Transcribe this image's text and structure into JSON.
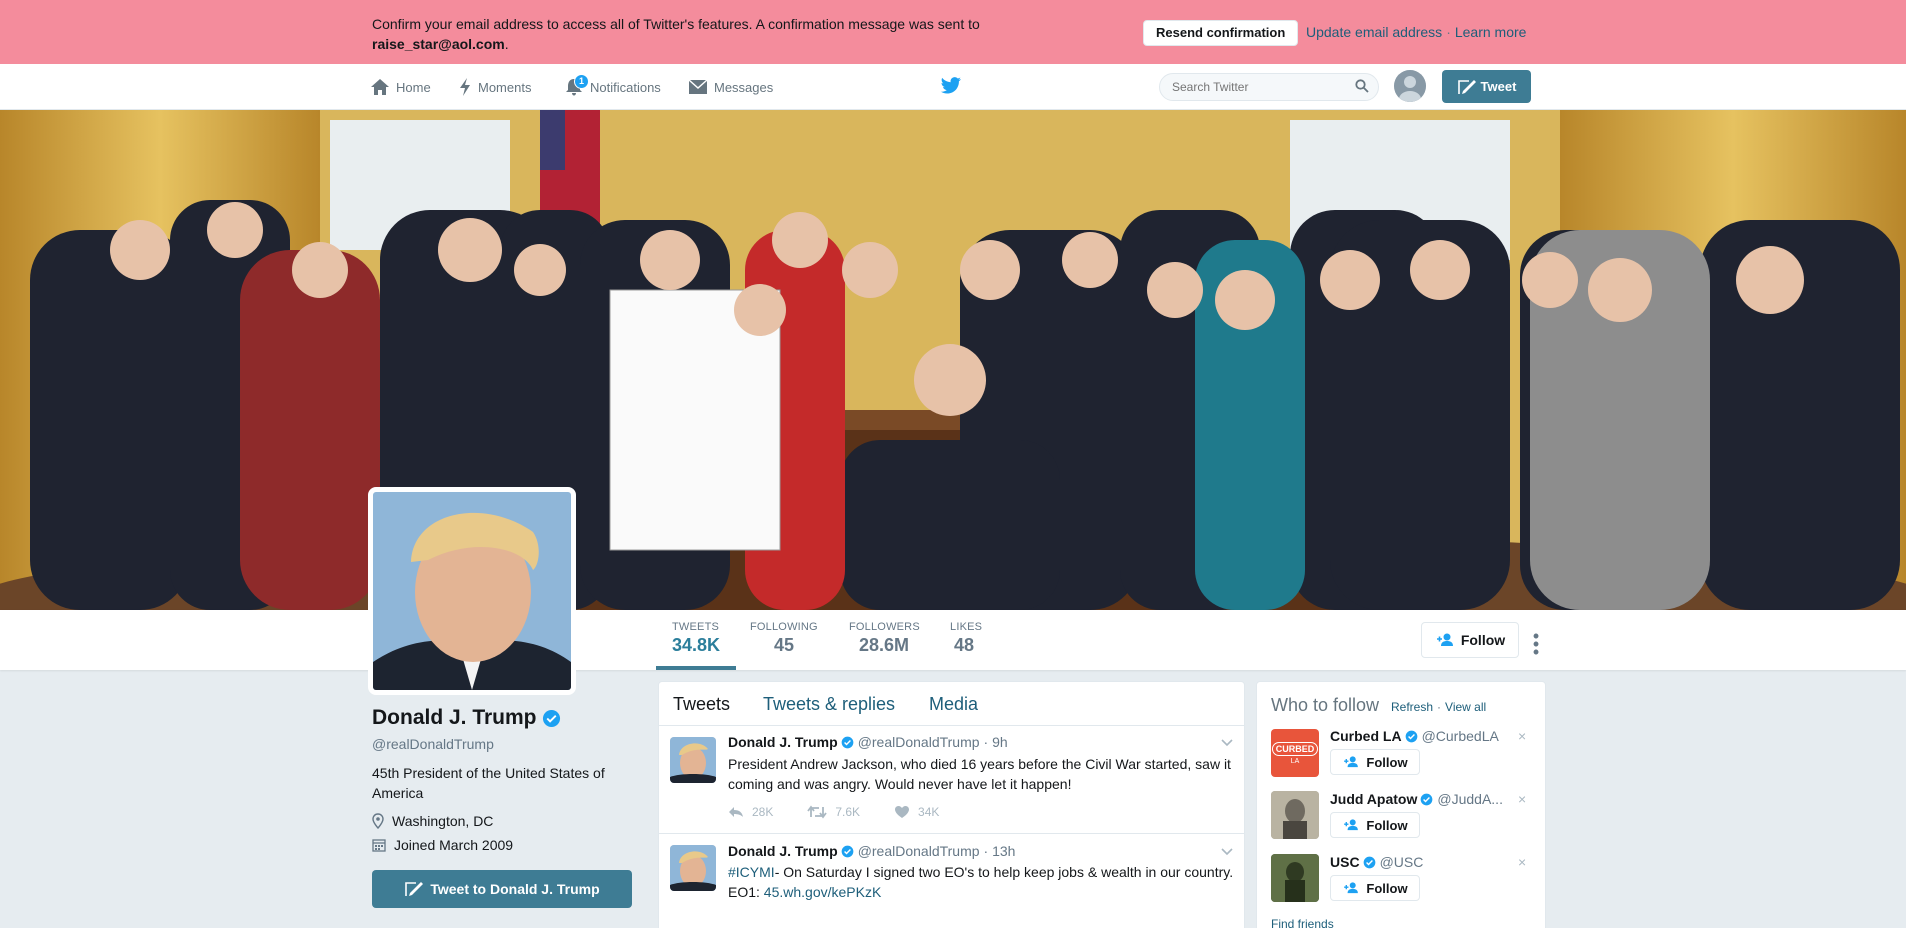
{
  "banner": {
    "message": "Confirm your email address to access all of Twitter's features. A confirmation message was sent to",
    "email": "raise_star@aol.com",
    "resend_label": "Resend confirmation",
    "update_label": "Update email address",
    "separator": "·",
    "learn_more_label": "Learn more",
    "bg_color": "#f48c9c"
  },
  "nav": {
    "items": [
      {
        "label": "Home",
        "icon": "home-icon"
      },
      {
        "label": "Moments",
        "icon": "lightning-icon"
      },
      {
        "label": "Notifications",
        "icon": "bell-icon",
        "badge": "1"
      },
      {
        "label": "Messages",
        "icon": "envelope-icon"
      }
    ],
    "search_placeholder": "Search Twitter",
    "tweet_button_label": "Tweet",
    "accent_color": "#3e7c94"
  },
  "profile": {
    "name": "Donald J. Trump",
    "handle": "@realDonaldTrump",
    "bio": "45th President of the United States of America",
    "location": "Washington, DC",
    "joined": "Joined March 2009",
    "tweet_to_label": "Tweet to Donald J. Trump",
    "verified": true
  },
  "stats": [
    {
      "label": "TWEETS",
      "value": "34.8K",
      "active": true
    },
    {
      "label": "FOLLOWING",
      "value": "45"
    },
    {
      "label": "FOLLOWERS",
      "value": "28.6M"
    },
    {
      "label": "LIKES",
      "value": "48"
    }
  ],
  "follow_button_label": "Follow",
  "timeline": {
    "tabs": [
      "Tweets",
      "Tweets & replies",
      "Media"
    ],
    "tweets": [
      {
        "name": "Donald J. Trump",
        "handle": "@realDonaldTrump",
        "time": "· 9h",
        "text": "President Andrew Jackson, who died 16 years before the Civil War started, saw it coming and was angry. Would never have let it happen!",
        "replies": "28K",
        "retweets": "7.6K",
        "likes": "34K"
      },
      {
        "name": "Donald J. Trump",
        "handle": "@realDonaldTrump",
        "time": "· 13h",
        "hashtag": "#ICYMI",
        "text": "- On Saturday I signed two EO's to help keep jobs & wealth in our country.",
        "line3_prefix": "EO1: ",
        "link": "45.wh.gov/kePKzK"
      }
    ]
  },
  "who_to_follow": {
    "title": "Who to follow",
    "separator": "·",
    "refresh_label": "Refresh",
    "view_all_label": "View all",
    "items": [
      {
        "name": "Curbed LA",
        "handle": "@CurbedLA",
        "follow_label": "Follow",
        "avatar_text": "CURBED",
        "avatar_subtext": "LA",
        "avatar_color": "#e8553b"
      },
      {
        "name": "Judd Apatow",
        "handle": "@JuddA...",
        "follow_label": "Follow"
      },
      {
        "name": "USC",
        "handle": "@USC",
        "follow_label": "Follow"
      }
    ],
    "close_glyph": "×",
    "find_friends_label": "Find friends"
  }
}
